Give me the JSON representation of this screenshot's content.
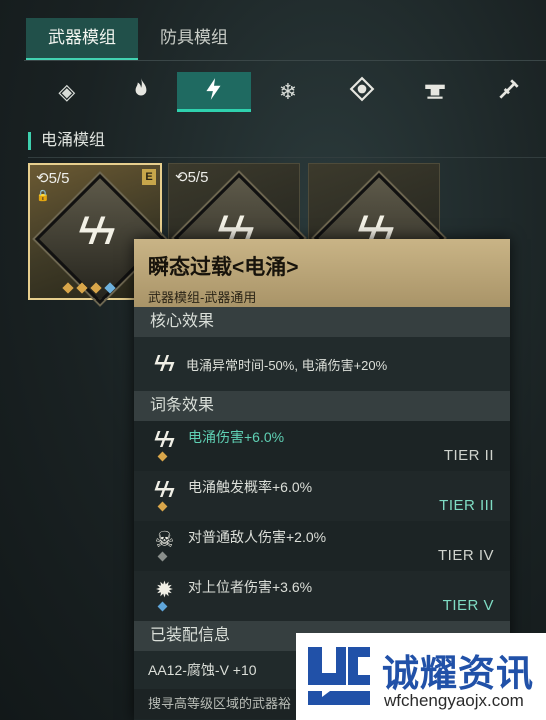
{
  "tabs": [
    {
      "label": "武器模组",
      "active": true
    },
    {
      "label": "防具模组",
      "active": false
    }
  ],
  "element_icons": [
    {
      "icon": "diamond-icon",
      "glyph": "◈",
      "active": false
    },
    {
      "icon": "flame-icon",
      "glyph": "🔥",
      "active": false
    },
    {
      "icon": "lightning-icon",
      "glyph": "ϟ",
      "active": true
    },
    {
      "icon": "snowflake-icon",
      "glyph": "❄",
      "active": false
    },
    {
      "icon": "poison-icon",
      "glyph": "✵",
      "active": false
    },
    {
      "icon": "turret-icon",
      "glyph": "▰",
      "active": false
    },
    {
      "icon": "blade-icon",
      "glyph": "✶",
      "active": false
    }
  ],
  "section": {
    "title": "电涌模组"
  },
  "cards": [
    {
      "count": "5/5",
      "locked": true,
      "tier_badge": "E",
      "selected": true
    },
    {
      "count": "5/5",
      "locked": false,
      "tier_badge": "",
      "selected": false
    },
    {
      "count": "",
      "locked": false,
      "tier_badge": "",
      "selected": false
    }
  ],
  "tooltip": {
    "title": "瞬态过载<电涌>",
    "subtitle": "武器模组-武器通用",
    "core_heading": "核心效果",
    "core_text": "电涌异常时间-50%, 电涌伤害+20%",
    "attr_heading": "词条效果",
    "attributes": [
      {
        "text": "电涌伤害+6.0%",
        "tier": "TIER II",
        "dot": "gold"
      },
      {
        "text": "电涌触发概率+6.0%",
        "tier": "TIER III",
        "dot": "gold"
      },
      {
        "text": "对普通敌人伤害+2.0%",
        "tier": "TIER IV",
        "dot": "grey"
      },
      {
        "text": "对上位者伤害+3.6%",
        "tier": "TIER V",
        "dot": "blue"
      }
    ],
    "equip_heading": "已装配信息",
    "equip_text": "AA12-腐蚀-V +10",
    "more_text": "搜寻高等级区域的武器裕"
  },
  "watermark": {
    "name": "诚耀资讯",
    "url": "wfchengyaojx.com"
  },
  "colors": {
    "accent": "#3ed0ae",
    "tooltip_header": "#c9b486",
    "gold": "#d9a64a",
    "blue": "#5fa6db"
  }
}
